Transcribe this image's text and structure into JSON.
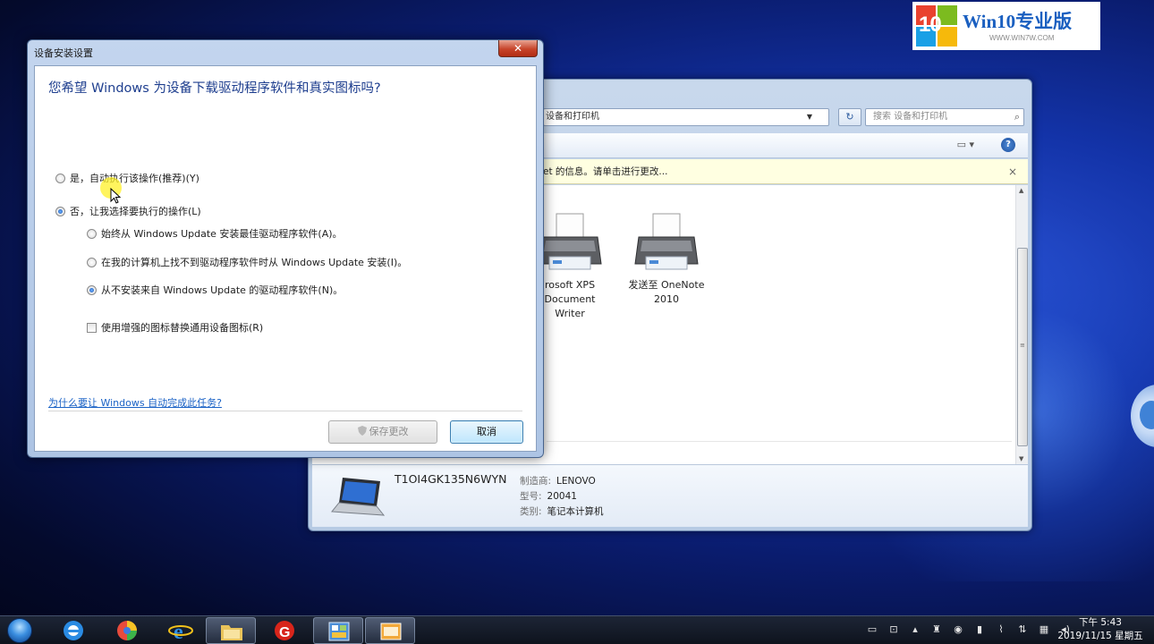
{
  "watermark": {
    "logo_number": "10",
    "title": "Win10专业版",
    "url": "WWW.WIN7W.COM"
  },
  "explorer": {
    "address": "设备和打印机",
    "search_placeholder": "搜索 设备和打印机",
    "info_bar": "et 的信息。请单击进行更改...",
    "devices": [
      {
        "line1": "rosoft XPS",
        "line2": "Document",
        "line3": "Writer"
      },
      {
        "line1": "发送至 OneNote",
        "line2": "2010",
        "line3": ""
      }
    ],
    "details": {
      "name": "T1OI4GK135N6WYN",
      "manufacturer_label": "制造商:",
      "manufacturer": "LENOVO",
      "model_label": "型号:",
      "model": "20041",
      "category_label": "类别:",
      "category": "笔记本计算机"
    }
  },
  "dialog": {
    "title": "设备安装设置",
    "close_label": "✕",
    "heading": "您希望 Windows 为设备下载驱动程序软件和真实图标吗?",
    "options": {
      "yes": {
        "label": "是，自动执行该操作(推荐)(Y)",
        "checked": false
      },
      "no": {
        "label": "否，让我选择要执行的操作(L)",
        "checked": true
      },
      "always": {
        "label": "始终从 Windows Update 安装最佳驱动程序软件(A)。",
        "checked": false
      },
      "if_not_found": {
        "label": "在我的计算机上找不到驱动程序软件时从 Windows Update 安装(I)。",
        "checked": false
      },
      "never": {
        "label": "从不安装来自 Windows Update 的驱动程序软件(N)。",
        "checked": true
      },
      "replace_icons": {
        "label": "使用增强的图标替换通用设备图标(R)",
        "checked": false
      }
    },
    "help_link": "为什么要让 Windows 自动完成此任务?",
    "save_button": "保存更改",
    "cancel_button": "取消"
  },
  "taskbar": {
    "clock_time": "下午 5:43",
    "clock_date": "2019/11/15 星期五"
  },
  "colors": {
    "heading_blue": "#1f3f8f",
    "link_blue": "#1a62c6",
    "close_red": "#c7442a",
    "info_yellow": "#ffffe1"
  }
}
